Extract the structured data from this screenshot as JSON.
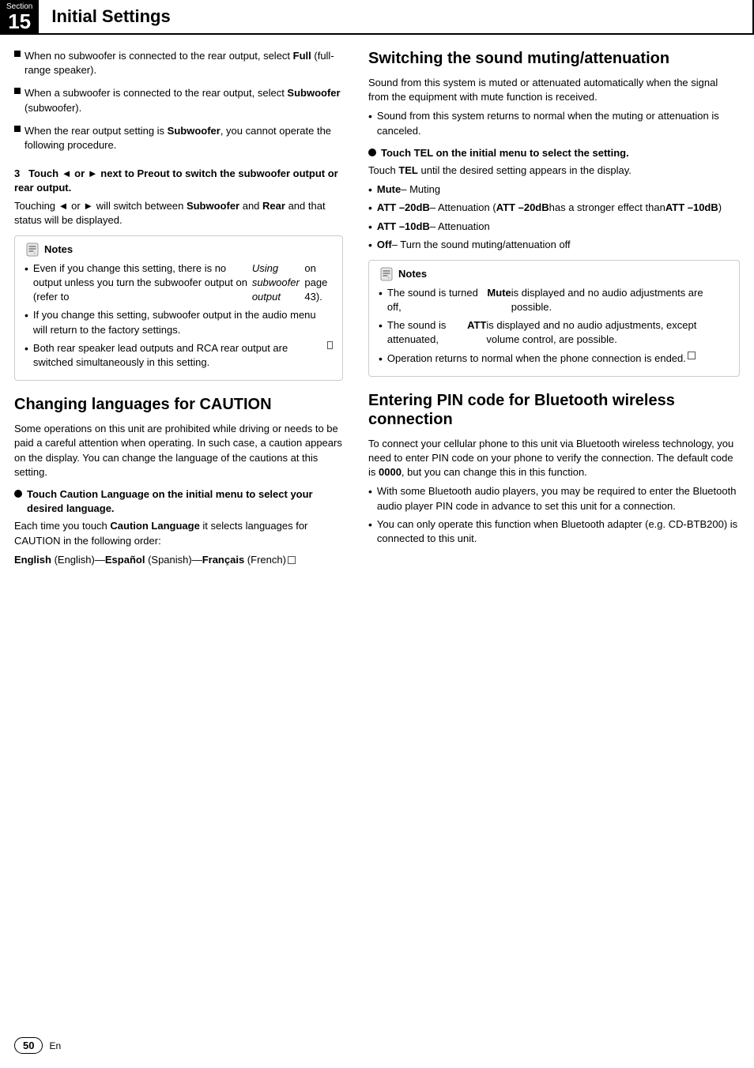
{
  "header": {
    "section_label": "Section",
    "section_number": "15",
    "title": "Initial Settings"
  },
  "left_col": {
    "square_bullets": [
      "When no subwoofer is connected to the rear output, select <b>Full</b> (full-range speaker).",
      "When a subwoofer is connected to the rear output, select <b>Subwoofer</b> (subwoofer).",
      "When the rear output setting is <b>Subwoofer</b>, you cannot operate the following procedure."
    ],
    "step3_heading": "3   Touch ◄ or ► next to Preout to switch the subwoofer output or rear output.",
    "step3_body": "Touching ◄ or ► will switch between <b>Subwoofer</b> and <b>Rear</b> and that status will be displayed.",
    "notes_title": "Notes",
    "notes_items": [
      "Even if you change this setting, there is no output unless you turn the subwoofer output on (refer to <i>Using subwoofer output</i> on page 43).",
      "If you change this setting, subwoofer output in the audio menu will return to the factory settings.",
      "Both rear speaker lead outputs and RCA rear output are switched simultaneously in this setting.■"
    ],
    "changing_lang_title": "Changing languages for CAUTION",
    "changing_lang_intro": "Some operations on this unit are prohibited while driving or needs to be paid a careful attention when operating. In such case, a caution appears on the display. You can change the language of the cautions at this setting.",
    "touch_caution_heading": "Touch Caution Language on the initial menu to select your desired language.",
    "touch_caution_body1": "Each time you touch <b>Caution Language</b> it selects languages for CAUTION in the following order:",
    "touch_caution_body2": "<b>English</b> (English)—<b>Español</b> (Spanish)—<b>Français</b> (French)■"
  },
  "right_col": {
    "switching_title": "Switching the sound muting/attenuation",
    "switching_intro": "Sound from this system is muted or attenuated automatically when the signal from the equipment with mute function is received.",
    "switching_note1": "Sound from this system returns to normal when the muting or attenuation is canceled.",
    "touch_tel_heading": "Touch TEL on the initial menu to select the setting.",
    "touch_tel_body": "Touch <b>TEL</b> until the desired setting appears in the display.",
    "tel_items": [
      "<b>Mute</b> – Muting",
      "<b>ATT –20dB</b> – Attenuation (<b>ATT –20dB</b> has a stronger effect than <b>ATT –10dB</b>)",
      "<b>ATT –10dB</b> – Attenuation",
      "<b>Off</b> – Turn the sound muting/attenuation off"
    ],
    "notes_title": "Notes",
    "notes_items": [
      "The sound is turned off, <b>Mute</b> is displayed and no audio adjustments are possible.",
      "The sound is attenuated, <b>ATT</b> is displayed and no audio adjustments, except volume control, are possible.",
      "Operation returns to normal when the phone connection is ended.■"
    ],
    "bluetooth_title": "Entering PIN code for Bluetooth wireless connection",
    "bluetooth_intro": "To connect your cellular phone to this unit via Bluetooth wireless technology, you need to enter PIN code on your phone to verify the connection. The default code is <b>0000</b>, but you can change this in this function.",
    "bluetooth_items": [
      "With some Bluetooth audio players, you may be required to enter the Bluetooth audio player PIN code in advance to set this unit for a connection.",
      "You can only operate this function when Bluetooth adapter (e.g. CD-BTB200) is connected to this unit."
    ]
  },
  "footer": {
    "page_number": "50",
    "language": "En"
  }
}
